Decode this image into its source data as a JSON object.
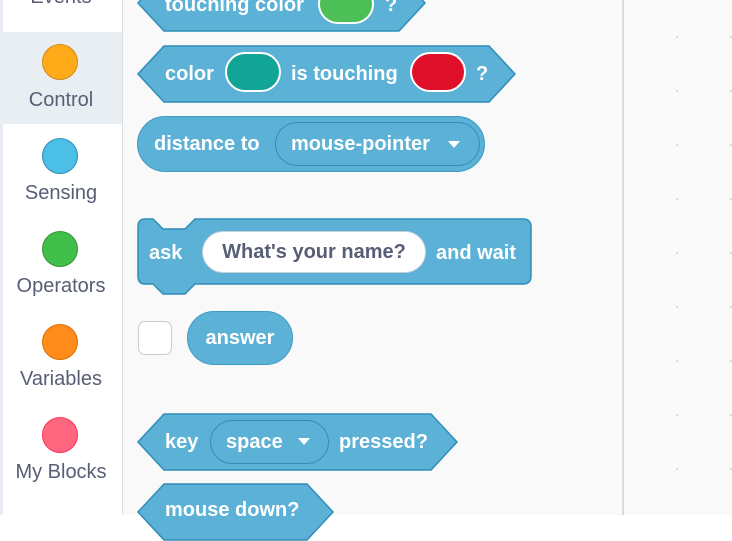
{
  "sidebar": {
    "items": [
      {
        "label": "Events",
        "color": "#ffbf00"
      },
      {
        "label": "Control",
        "color": "#ffab19",
        "selected": true
      },
      {
        "label": "Sensing",
        "color": "#5cb1d6"
      },
      {
        "label": "Operators",
        "color": "#59c059"
      },
      {
        "label": "Variables",
        "color": "#ff8c1a"
      },
      {
        "label": "My Blocks",
        "color": "#ff6680"
      }
    ]
  },
  "palette": {
    "block_color": "#5cb1d6",
    "touching_color": {
      "label": "touching color",
      "question": "?",
      "swatch": "#4cbf56"
    },
    "color_touching": {
      "label": "color",
      "middle": "is touching",
      "question": "?",
      "swatch1": "#11a497",
      "swatch2": "#e0102b"
    },
    "distance_to": {
      "label": "distance to",
      "menu": "mouse-pointer"
    },
    "ask": {
      "label": "ask",
      "input": "What's your name?",
      "suffix": "and wait"
    },
    "answer": {
      "label": "answer"
    },
    "key_pressed": {
      "label": "key",
      "menu": "space",
      "suffix": "pressed?"
    },
    "mouse_down": {
      "label": "mouse down?"
    }
  }
}
